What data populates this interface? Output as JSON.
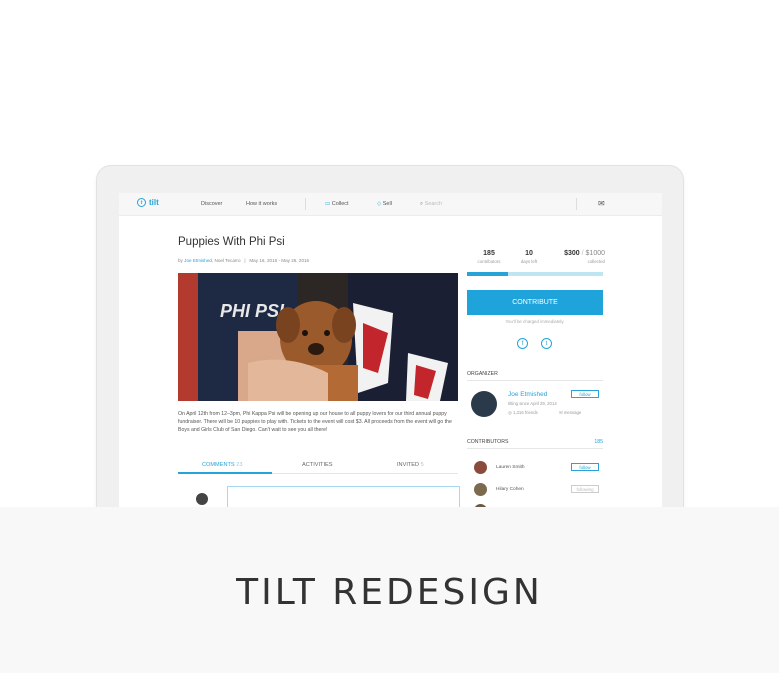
{
  "nav": {
    "logo": "tilt",
    "discover": "Discover",
    "how_it_works": "How it works",
    "collect": "Collect",
    "sell": "Sell",
    "search_placeholder": "Search"
  },
  "campaign": {
    "title": "Puppies With Phi Psi",
    "by_prefix": "by",
    "organizer_link": "Joe Etmished",
    "coorganizer": ", Noel Tecarro",
    "dates": "May 16, 2016 - May 26, 2016",
    "description": "On April 12th from 12–3pm, Phi Kappa Psi will be opening up our house to all puppy lovers for our third annual puppy fundraiser. There will be 10 puppies to play with. Tickets to the event will cost $3. All proceeds from the event will go the Boys and Girls Club of San Diego. Can't wait to see you all there!"
  },
  "tabs": {
    "comments": "COMMENTS",
    "comments_count": "23",
    "activities": "ACTIVITIES",
    "invited": "INVITED",
    "invited_count": "5"
  },
  "stats": {
    "contributors_value": "185",
    "contributors_label": "contributors",
    "days_value": "10",
    "days_label": "days left",
    "collected_value": "$300",
    "collected_sep": "/",
    "goal_value": "$1000",
    "collected_label": "collected",
    "progress_fraction": 0.3
  },
  "contribute": {
    "button": "CONTRIBUTE",
    "note": "You'll be charged immediately."
  },
  "organizer": {
    "heading": "ORGANIZER",
    "name": "Joe Etmished",
    "since": "tilting since April 29, 2014",
    "friends": "1,316 friends",
    "message": "message",
    "follow": "follow"
  },
  "contributors": {
    "heading": "CONTRIBUTORS",
    "count": "185",
    "list": [
      {
        "name": "Lauren Smith",
        "action": "follow"
      },
      {
        "name": "Hilary Cohen",
        "action": "following"
      }
    ]
  },
  "headline": "TILT REDESIGN"
}
